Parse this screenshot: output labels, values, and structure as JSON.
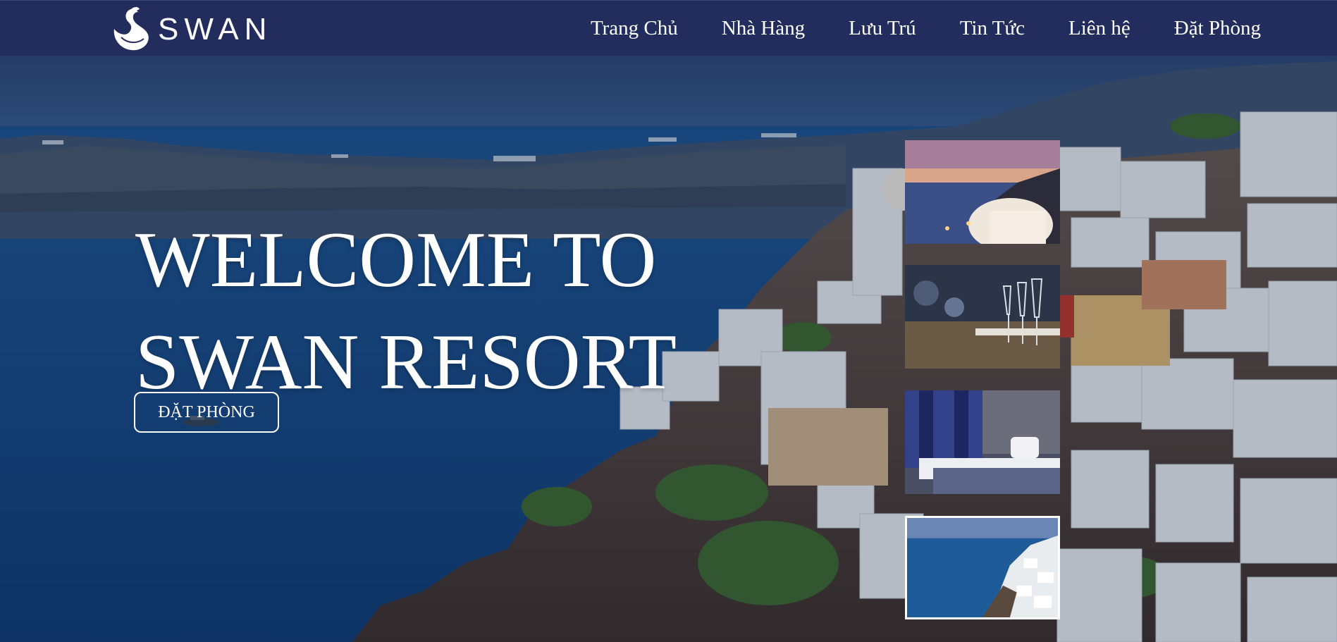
{
  "brand": {
    "name": "SWAN",
    "logo_icon": "swan-icon"
  },
  "nav": {
    "items": [
      {
        "label": "Trang Chủ"
      },
      {
        "label": "Nhà Hàng"
      },
      {
        "label": "Lưu Trú"
      },
      {
        "label": "Tin Tức"
      },
      {
        "label": "Liên hệ"
      },
      {
        "label": "Đặt Phòng"
      }
    ]
  },
  "hero": {
    "title_line1": "WELCOME TO",
    "title_line2": "SWAN RESORT",
    "cta_label": "ĐẶT PHÒNG",
    "background": "santorini-cliffside-photo"
  },
  "gallery": {
    "thumbnails": [
      {
        "subject": "sunset-terrace-photo"
      },
      {
        "subject": "restaurant-glasses-photo"
      },
      {
        "subject": "hotel-bedroom-photo"
      },
      {
        "subject": "sea-view-photo",
        "selected": true
      }
    ]
  },
  "colors": {
    "header_bg": "#222d5e",
    "text": "#ffffff",
    "sea": "#1e4f8c"
  }
}
